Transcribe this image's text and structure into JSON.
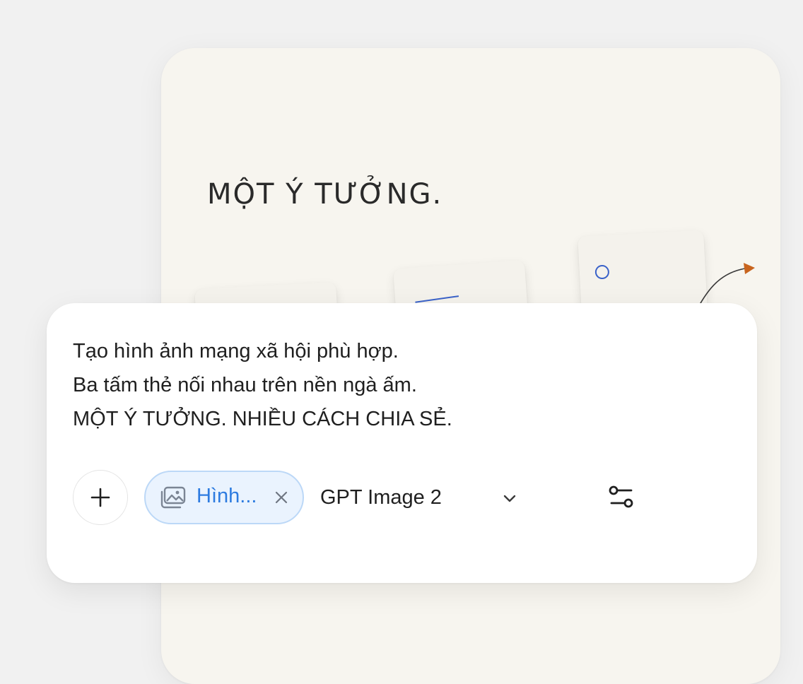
{
  "preview": {
    "headline": "MỘT Ý TƯỞNG."
  },
  "composer": {
    "prompt_lines": [
      "Tạo hình ảnh mạng xã hội phù hợp.",
      "Ba tấm thẻ nối nhau trên nền ngà ấm.",
      "MỘT Ý TƯỞNG. NHIỀU CÁCH CHIA SẺ."
    ],
    "chip": {
      "label": "Hình...",
      "icon": "image-icon"
    },
    "model": {
      "selected": "GPT Image 2"
    },
    "icons": {
      "add": "plus-icon",
      "close": "close-icon",
      "dropdown": "chevron-down-icon",
      "settings": "sliders-icon"
    }
  },
  "colors": {
    "accent_blue": "#2d7be0",
    "chip_bg": "#eaf3fe",
    "chip_border": "#bcd8f7",
    "preview_bg": "#f7f5ef",
    "arrow_orange": "#c8641e"
  }
}
